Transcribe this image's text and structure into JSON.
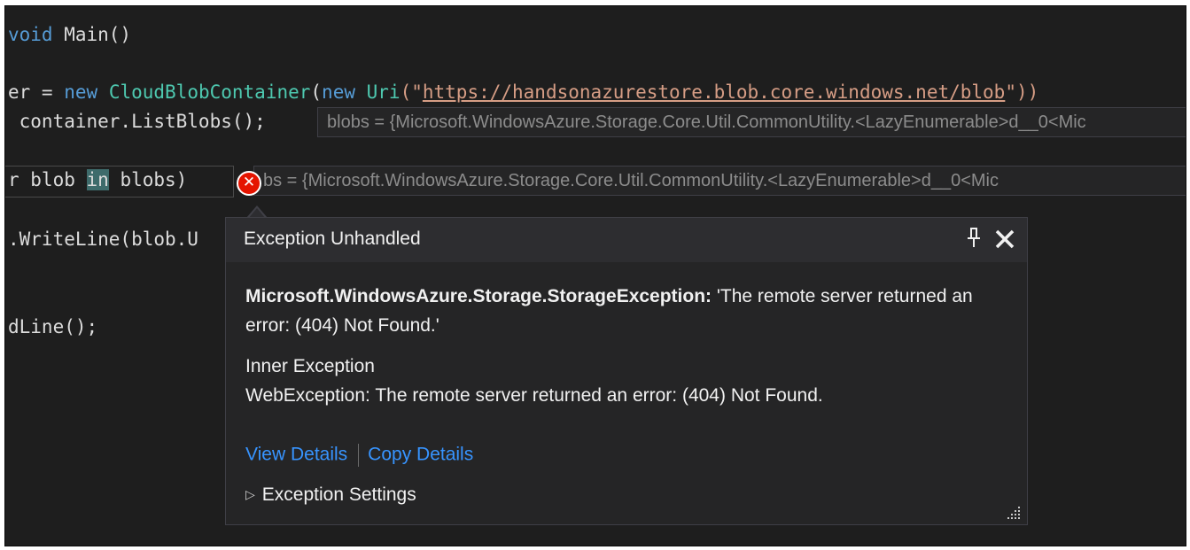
{
  "code": {
    "line1_kw": "void",
    "line1_rest": " Main()",
    "line2_a": "er = ",
    "line2_new": "new",
    "line2_type": "CloudBlobContainer",
    "line2_paren": "(",
    "line2_new2": "new",
    "line2_uri": "Uri",
    "line2_quote_open": "(\"",
    "line2_url": "https://handsonazurestore.blob.core.windows.net/blob",
    "line2_quote_close": "\"))",
    "line3": " container.ListBlobs();",
    "line4_a": "r blob ",
    "line4_in": "in",
    "line4_b": " blobs)",
    "line5": ".WriteLine(blob.U",
    "line6": "dLine();"
  },
  "datatips": {
    "blobs_top": "blobs = {Microsoft.WindowsAzure.Storage.Core.Util.CommonUtility.<LazyEnumerable>d__0<Mic",
    "blobs_mid": "bs = {Microsoft.WindowsAzure.Storage.Core.Util.CommonUtility.<LazyEnumerable>d__0<Mic"
  },
  "popup": {
    "title": "Exception Unhandled",
    "exception_type": "Microsoft.WindowsAzure.Storage.StorageException:",
    "exception_message": " 'The remote server returned an error: (404) Not Found.'",
    "inner_label": "Inner Exception",
    "inner_message": "WebException: The remote server returned an error: (404) Not Found.",
    "view_details": "View Details",
    "copy_details": "Copy Details",
    "settings": "Exception Settings",
    "error_glyph": "✕"
  },
  "icons": {
    "error": "error-circle-icon",
    "pin": "pin-icon",
    "close": "close-icon",
    "expand": "triangle-right-icon",
    "resize": "resize-grip-icon"
  },
  "colors": {
    "editor_bg": "#1e1e1e",
    "keyword": "#569cd6",
    "type": "#4ec9b0",
    "string": "#d69d85",
    "link": "#3794ff",
    "error": "#e51400"
  }
}
